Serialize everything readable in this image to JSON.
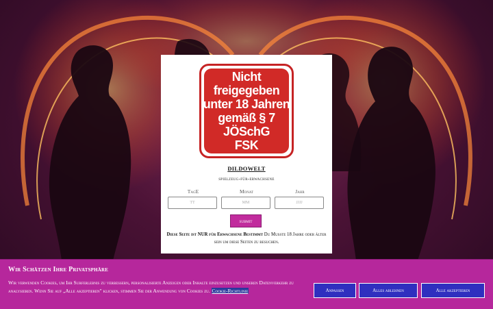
{
  "age_gate": {
    "sign_lines": [
      "Nicht",
      "freigegeben",
      "unter 18 Jahren",
      "gemäß § 7",
      "JÖSchG",
      "FSK"
    ],
    "site_name": "DILDOWELT",
    "site_subtitle": "spielzeug-für-erwachsene",
    "labels": {
      "day": "TagE",
      "month": "Monat",
      "year": "Jahr"
    },
    "placeholders": {
      "day": "TT",
      "month": "MM",
      "year": "JJJJ"
    },
    "submit_label": "submit",
    "notice_bold": "Diese Seite ist NUR für Erwachsene Bestimmt",
    "notice_rest": " Du Musste 18 Jahre oder älter sein um diese Seiten zu besuchen."
  },
  "cookie_banner": {
    "title": "Wir Schätzen Ihre Privatsphäre",
    "text": "Wir verwenden Cookies, um Ihr Surferlebnis zu verbessern, personalisierte Anzeigen oder Inhalte einzusetzen und unseren Datenverkehr zu analysieren. Wenn Sie auf „Alle akzeptieren\" klicken, stimmen Sie der Anwendung von Cookies zu.",
    "policy_link": "Cookie-Richtlinie",
    "buttons": {
      "customize": "Anpassen",
      "reject_all": "Alles ablehnen",
      "accept_all": "Alle akzeptieren"
    }
  },
  "colors": {
    "background": "#4a1235",
    "sign_red": "#d12a27",
    "submit": "#c12c9d",
    "cookie_banner": "#b6279c",
    "cookie_button": "#2f2fbf"
  }
}
